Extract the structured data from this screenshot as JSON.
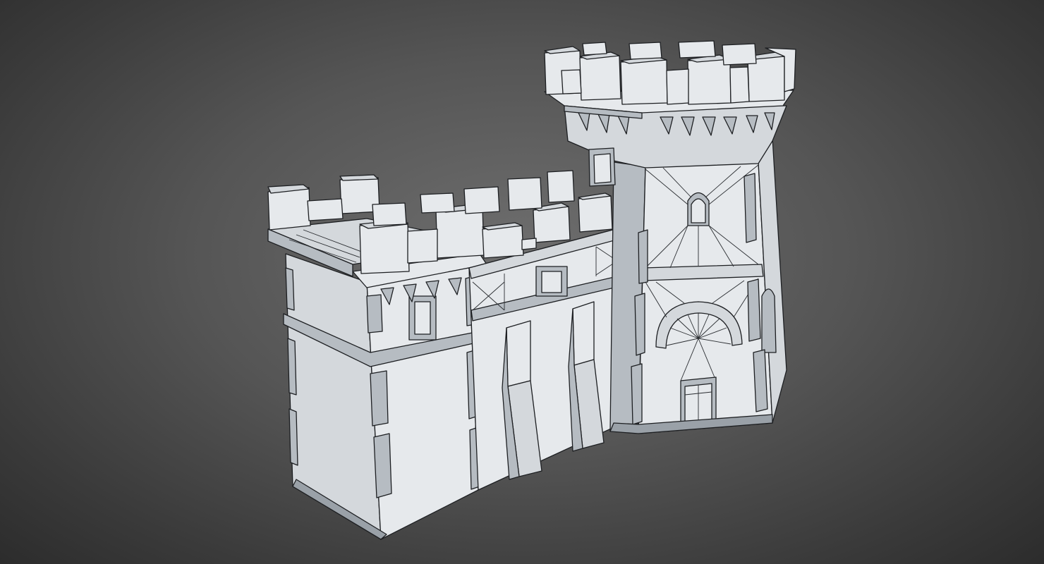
{
  "scene": {
    "subject": "castle-gatehouse-model",
    "colors": {
      "background_center": "#6e6e6e",
      "background_edge": "#2c2c2c",
      "model_surface": "#e6e9ec",
      "wireframe": "#1d1f22"
    }
  }
}
